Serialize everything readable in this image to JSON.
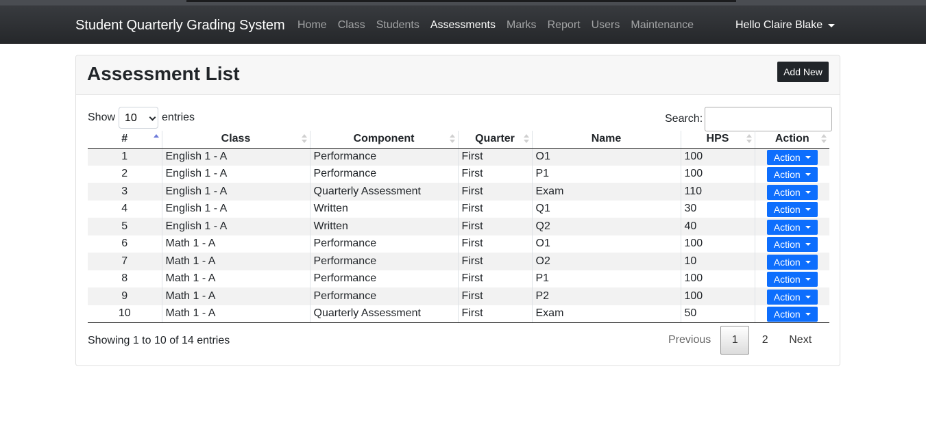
{
  "navbar": {
    "brand": "Student Quarterly Grading System",
    "items": [
      {
        "label": "Home",
        "active": false
      },
      {
        "label": "Class",
        "active": false
      },
      {
        "label": "Students",
        "active": false
      },
      {
        "label": "Assessments",
        "active": true
      },
      {
        "label": "Marks",
        "active": false
      },
      {
        "label": "Report",
        "active": false
      },
      {
        "label": "Users",
        "active": false
      },
      {
        "label": "Maintenance",
        "active": false
      }
    ],
    "user_greeting": "Hello Claire Blake"
  },
  "card": {
    "title": "Assessment List",
    "add_button": "Add New"
  },
  "table_controls": {
    "show_label": "Show",
    "entries_value": "10",
    "entries_label": "entries",
    "search_label": "Search:",
    "search_value": ""
  },
  "table": {
    "columns": [
      "#",
      "Class",
      "Component",
      "Quarter",
      "Name",
      "HPS",
      "Action"
    ],
    "rows": [
      [
        "1",
        "English 1 - A",
        "Performance",
        "First",
        "O1",
        "100"
      ],
      [
        "2",
        "English 1 - A",
        "Performance",
        "First",
        "P1",
        "100"
      ],
      [
        "3",
        "English 1 - A",
        "Quarterly Assessment",
        "First",
        "Exam",
        "110"
      ],
      [
        "4",
        "English 1 - A",
        "Written",
        "First",
        "Q1",
        "30"
      ],
      [
        "5",
        "English 1 - A",
        "Written",
        "First",
        "Q2",
        "40"
      ],
      [
        "6",
        "Math 1 - A",
        "Performance",
        "First",
        "O1",
        "100"
      ],
      [
        "7",
        "Math 1 - A",
        "Performance",
        "First",
        "O2",
        "10"
      ],
      [
        "8",
        "Math 1 - A",
        "Performance",
        "First",
        "P1",
        "100"
      ],
      [
        "9",
        "Math 1 - A",
        "Performance",
        "First",
        "P2",
        "100"
      ],
      [
        "10",
        "Math 1 - A",
        "Quarterly Assessment",
        "First",
        "Exam",
        "50"
      ]
    ],
    "action_label": "Action"
  },
  "footer": {
    "info": "Showing 1 to 10 of 14 entries",
    "previous": "Previous",
    "pages": [
      "1",
      "2"
    ],
    "current_page": "1",
    "next": "Next"
  },
  "colors": {
    "navbar": "#2f3236",
    "action_button": "#0d6efd",
    "add_button": "#212529"
  }
}
